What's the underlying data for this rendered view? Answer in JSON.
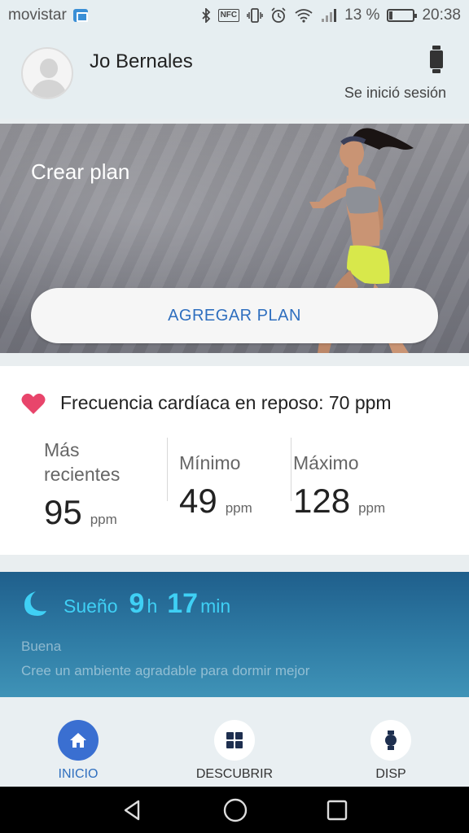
{
  "status_bar": {
    "carrier": "movistar",
    "nfc": "NFC",
    "battery_percent": "13 %",
    "battery_level": 0.13,
    "time": "20:38"
  },
  "profile": {
    "user_name": "Jo Bernales",
    "session_status": "Se inició sesión"
  },
  "plan": {
    "title": "Crear plan",
    "button_label": "AGREGAR PLAN"
  },
  "heart_rate": {
    "title": "Frecuencia cardíaca en reposo: 70 ppm",
    "stats": [
      {
        "label_line1": "Más",
        "label_line2": "recientes",
        "value": "95",
        "unit": "ppm"
      },
      {
        "label": "Mínimo",
        "value": "49",
        "unit": "ppm"
      },
      {
        "label": "Máximo",
        "value": "128",
        "unit": "ppm"
      }
    ],
    "accent_color": "#e8456b"
  },
  "sleep": {
    "label": "Sueño",
    "hours": "9",
    "hours_unit": "h",
    "minutes": "17",
    "minutes_unit": "min",
    "quality": "Buena",
    "tip": "Cree un ambiente agradable para dormir mejor",
    "accent_color": "#3fd0f5"
  },
  "bottom_nav": {
    "items": [
      {
        "label": "INICIO",
        "icon": "home-icon",
        "active": true
      },
      {
        "label": "DESCUBRIR",
        "icon": "grid-icon",
        "active": false
      },
      {
        "label": "DISP",
        "icon": "watch-icon",
        "active": false
      }
    ]
  },
  "colors": {
    "brand_blue": "#2f6fbf",
    "active_nav": "#3a6fd1"
  }
}
